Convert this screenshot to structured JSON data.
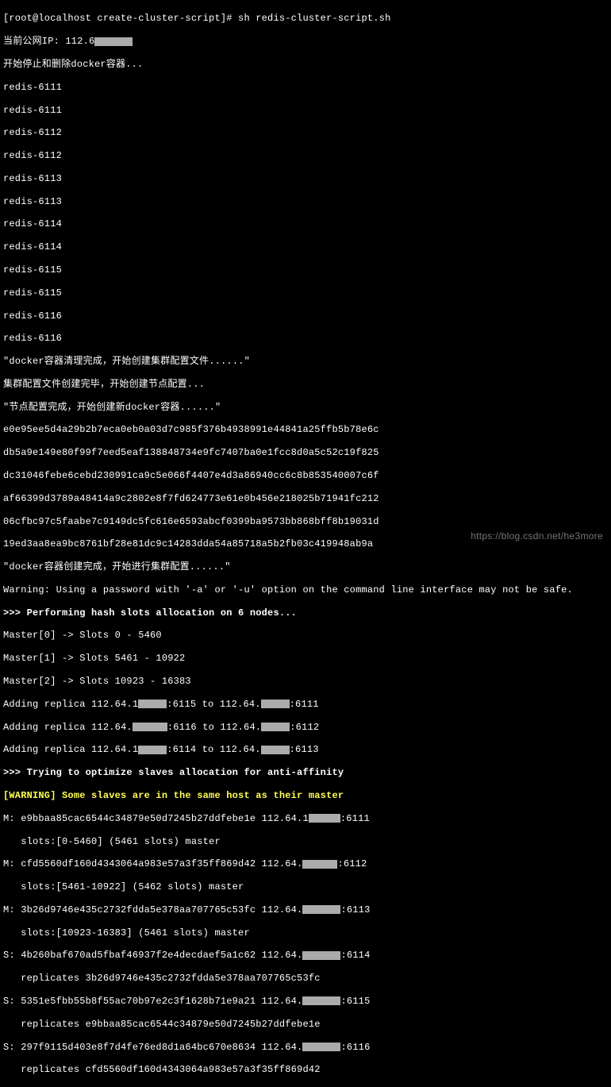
{
  "prompt": "[root@localhost create-cluster-script]# sh redis-cluster-script.sh",
  "ip_line_prefix": "当前公网IP: 112.6",
  "msg_stop_delete": "开始停止和删除docker容器...",
  "redis_lines": [
    "redis-6111",
    "redis-6111",
    "redis-6112",
    "redis-6112",
    "redis-6113",
    "redis-6113",
    "redis-6114",
    "redis-6114",
    "redis-6115",
    "redis-6115",
    "redis-6116",
    "redis-6116"
  ],
  "msg_cleanup": "\"docker容器清理完成，开始创建集群配置文件......\"",
  "msg_config_done": "集群配置文件创建完毕，开始创建节点配置...",
  "msg_node_done": "\"节点配置完成，开始创建新docker容器......\"",
  "hashes": [
    "e0e95ee5d4a29b2b7eca0eb0a03d7c985f376b4938991e44841a25ffb5b78e6c",
    "db5a9e149e80f99f7eed5eaf138848734e9fc7407ba0e1fcc8d0a5c52c19f825",
    "dc31046febe6cebd230991ca9c5e066f4407e4d3a86940cc6c8b853540007c6f",
    "af66399d3789a48414a9c2802e8f7fd624773e61e0b456e218025b71941fc212",
    "06cfbc97c5faabe7c9149dc5fc616e6593abcf0399ba9573bb868bff8b19031d",
    "19ed3aa8ea9bc8761bf28e81dc9c14283dda54a85718a5b2fb03c419948ab9a"
  ],
  "msg_create_done": "\"docker容器创建完成，开始进行集群配置......\"",
  "warn_password": "Warning: Using a password with '-a' or '-u' option on the command line interface may not be safe.",
  "hash_alloc": ">>> Performing hash slots allocation on 6 nodes...",
  "masters": [
    "Master[0] -> Slots 0 - 5460",
    "Master[1] -> Slots 5461 - 10922",
    "Master[2] -> Slots 10923 - 16383"
  ],
  "replicas": [
    {
      "pre": "Adding replica 112.64.1",
      "mid": ":6115 to 112.64.",
      "post": ":6111"
    },
    {
      "pre": "Adding replica 112.64.",
      "mid": ":6116 to 112.64.",
      "post": ":6112"
    },
    {
      "pre": "Adding replica 112.64.1",
      "mid": ":6114 to 112.64.",
      "post": ":6113"
    }
  ],
  "optimize": ">>> Trying to optimize slaves allocation for anti-affinity",
  "warn_same_host": "[WARNING] Some slaves are in the same host as their master",
  "nodes": [
    {
      "pre": "M: e9bbaa85cac6544c34879e50d7245b27ddfebe1e 112.64.1",
      "post": ":6111",
      "sub": "   slots:[0-5460] (5461 slots) master"
    },
    {
      "pre": "M: cfd5560df160d4343064a983e57a3f35ff869d42 112.64.",
      "post": ":6112",
      "sub": "   slots:[5461-10922] (5462 slots) master"
    },
    {
      "pre": "M: 3b26d9746e435c2732fdda5e378aa707765c53fc 112.64.",
      "post": ":6113",
      "sub": "   slots:[10923-16383] (5461 slots) master"
    },
    {
      "pre": "S: 4b260baf670ad5fbaf46937f2e4decdaef5a1c62 112.64.",
      "post": ":6114",
      "sub": "   replicates 3b26d9746e435c2732fdda5e378aa707765c53fc"
    },
    {
      "pre": "S: 5351e5fbb55b8f55ac70b97e2c3f1628b71e9a21 112.64.",
      "post": ":6115",
      "sub": "   replicates e9bbaa85cac6544c34879e50d7245b27ddfebe1e"
    },
    {
      "pre": "S: 297f9115d403e8f7d4fe76ed8d1a64bc670e8634 112.64.",
      "post": ":6116",
      "sub": "   replicates cfd5560df160d4343064a983e57a3f35ff869d42"
    }
  ],
  "watermark": "https://blog.csdn.net/he3more"
}
